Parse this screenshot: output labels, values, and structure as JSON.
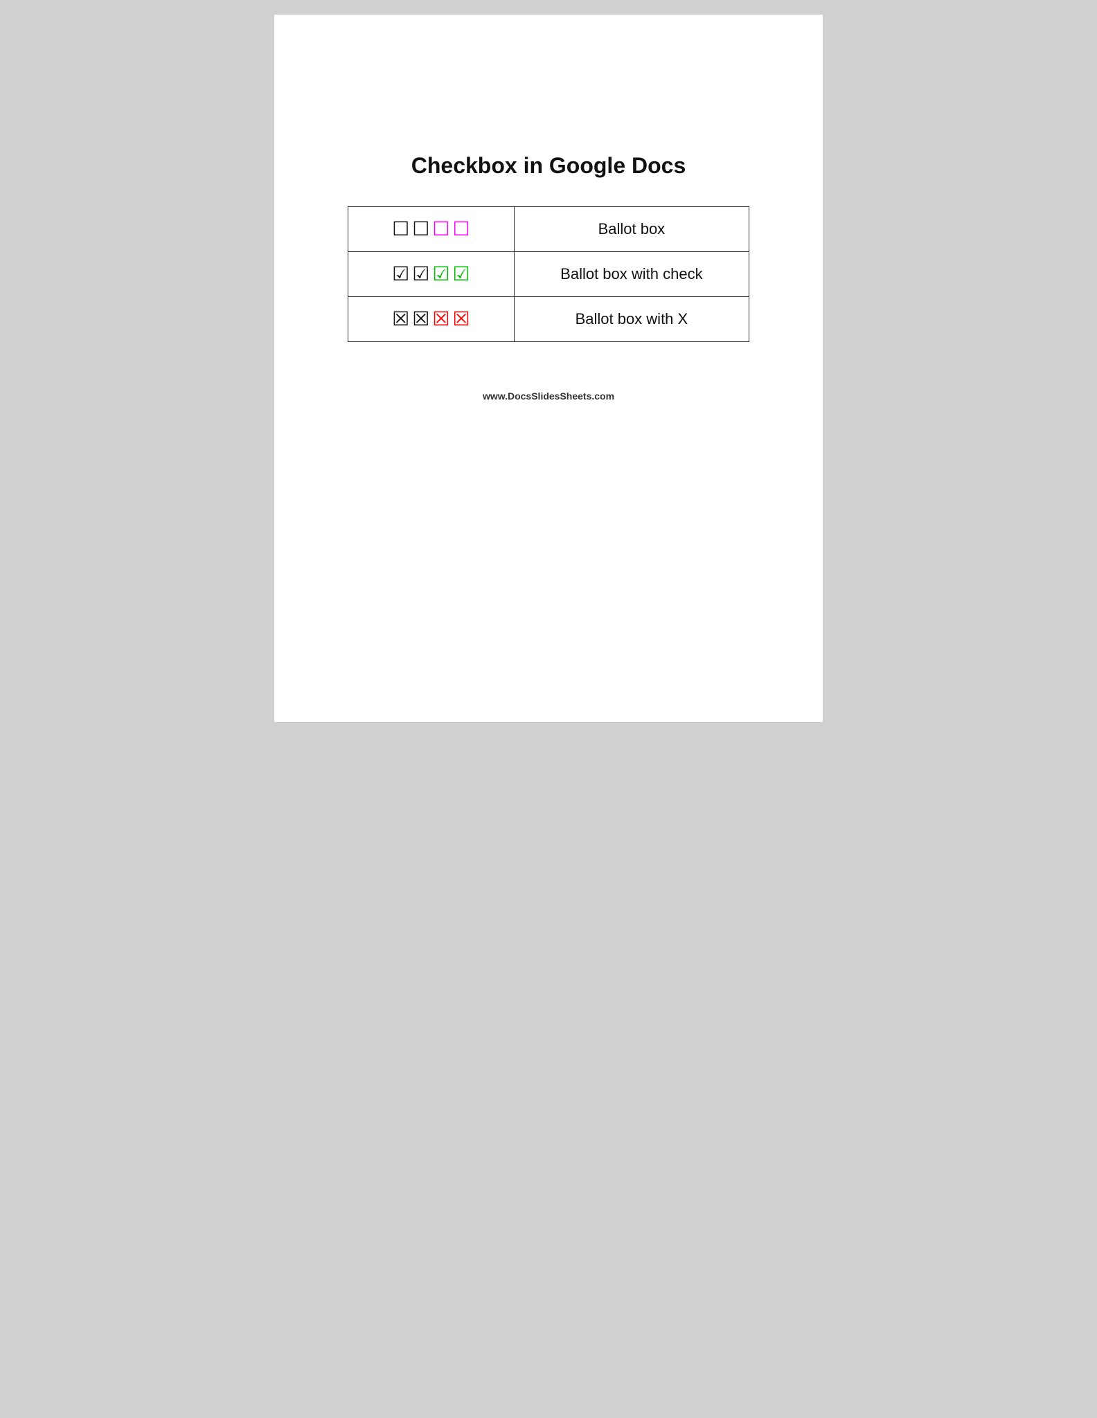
{
  "page": {
    "title": "Checkbox in Google Docs",
    "website": "www.DocsSlidesSheets.com"
  },
  "table": {
    "rows": [
      {
        "symbols": [
          {
            "char": "☐",
            "color": "black"
          },
          {
            "char": "☐",
            "color": "black"
          },
          {
            "char": "☐",
            "color": "magenta"
          },
          {
            "char": "☐",
            "color": "magenta"
          }
        ],
        "label": "Ballot box"
      },
      {
        "symbols": [
          {
            "char": "☑",
            "color": "black"
          },
          {
            "char": "☑",
            "color": "black"
          },
          {
            "char": "☑",
            "color": "green"
          },
          {
            "char": "☑",
            "color": "green"
          }
        ],
        "label": "Ballot box with check"
      },
      {
        "symbols": [
          {
            "char": "☒",
            "color": "black"
          },
          {
            "char": "☒",
            "color": "black"
          },
          {
            "char": "☒",
            "color": "red"
          },
          {
            "char": "☒",
            "color": "red"
          }
        ],
        "label": "Ballot box with X"
      }
    ]
  }
}
